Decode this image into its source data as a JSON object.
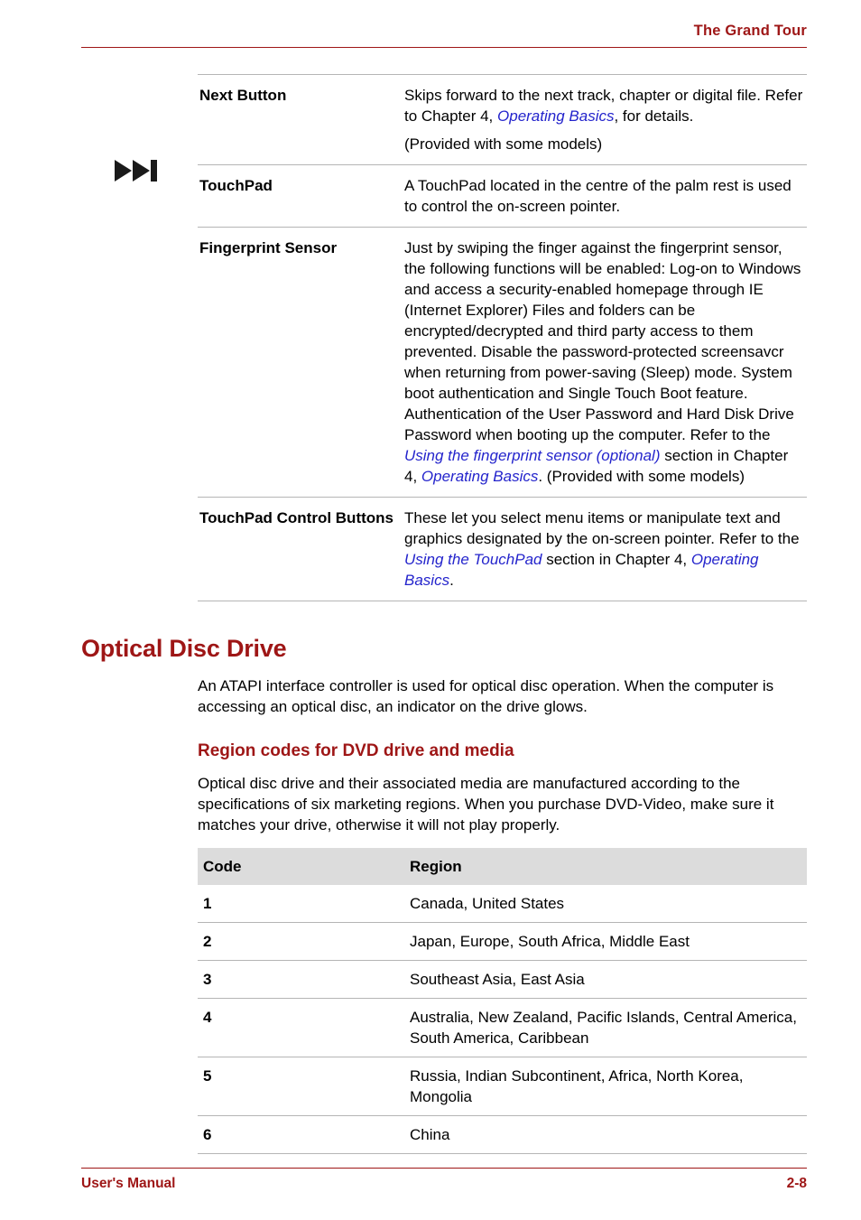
{
  "header": {
    "title": "The Grand Tour"
  },
  "features_table": {
    "icon": "next-track-icon",
    "rows": [
      {
        "term": "Next Button",
        "paragraphs": [
          [
            {
              "t": "Skips forward to the next track, chapter or digital file. Refer to Chapter 4, ",
              "style": "plain"
            },
            {
              "t": "Operating Basics",
              "style": "xref"
            },
            {
              "t": ", for details.",
              "style": "plain"
            }
          ],
          [
            {
              "t": "(Provided with some models)",
              "style": "plain"
            }
          ]
        ]
      },
      {
        "term": "TouchPad",
        "paragraphs": [
          [
            {
              "t": "A TouchPad located in the centre of the palm rest is used to control the on-screen pointer.",
              "style": "plain"
            }
          ]
        ]
      },
      {
        "term": "Fingerprint Sensor",
        "paragraphs": [
          [
            {
              "t": "Just by swiping the finger against the fingerprint sensor, the following functions will be enabled: Log-on to Windows and access a security-enabled homepage through IE (Internet Explorer) Files and folders can be encrypted/decrypted and third party access to them prevented. Disable the password-protected screensavcr when returning from power-saving (Sleep) mode. System boot authentication and Single Touch Boot feature. Authentication of the User Password and Hard Disk Drive Password when booting up the computer. Refer to the ",
              "style": "plain"
            },
            {
              "t": "Using the fingerprint sensor (optional)",
              "style": "xref"
            },
            {
              "t": " section in Chapter 4, ",
              "style": "plain"
            },
            {
              "t": "Operating Basics",
              "style": "xref"
            },
            {
              "t": ". (Provided with some models)",
              "style": "plain"
            }
          ]
        ]
      },
      {
        "term": "TouchPad Control Buttons",
        "paragraphs": [
          [
            {
              "t": "These let you select menu items or manipulate text and graphics designated by the on-screen pointer. Refer to the ",
              "style": "plain"
            },
            {
              "t": "Using the TouchPad",
              "style": "xref"
            },
            {
              "t": " section in Chapter 4, ",
              "style": "plain"
            },
            {
              "t": "Operating Basics",
              "style": "xref"
            },
            {
              "t": ".",
              "style": "plain"
            }
          ]
        ]
      }
    ]
  },
  "optical_section": {
    "title": "Optical Disc Drive",
    "paragraph": "An ATAPI interface controller is used for optical disc operation. When the computer is accessing an optical disc, an indicator on the drive glows."
  },
  "region_section": {
    "title": "Region codes for DVD drive and media",
    "paragraph": "Optical disc drive and their associated media are manufactured according to the specifications of six marketing regions. When you purchase DVD-Video, make sure it matches your drive, otherwise it will not play properly.",
    "table": {
      "columns": [
        "Code",
        "Region"
      ],
      "rows": [
        [
          "1",
          "Canada, United States"
        ],
        [
          "2",
          "Japan, Europe, South Africa, Middle East"
        ],
        [
          "3",
          "Southeast Asia, East Asia"
        ],
        [
          "4",
          "Australia, New Zealand, Pacific Islands, Central America, South America, Caribbean"
        ],
        [
          "5",
          "Russia, Indian Subcontinent, Africa, North Korea, Mongolia"
        ],
        [
          "6",
          "China"
        ]
      ]
    }
  },
  "footer": {
    "left": "User's Manual",
    "right": "2-8"
  },
  "colors": {
    "accent_red": "#9e1616",
    "xref_blue": "#2424cc",
    "table_header_gray": "#dcdcdc",
    "rule_gray": "#b5b5b5"
  }
}
